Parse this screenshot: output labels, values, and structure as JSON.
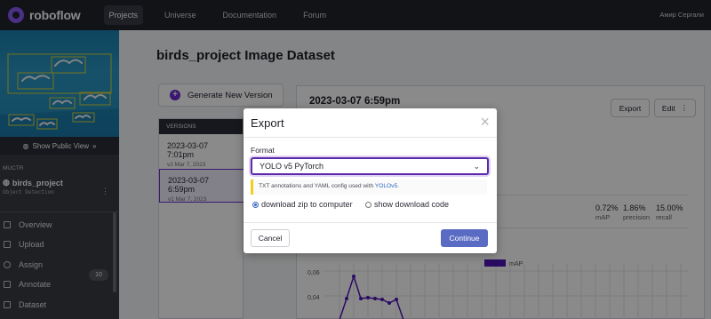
{
  "brand": {
    "name": "roboflow"
  },
  "nav": {
    "items": [
      "Projects",
      "Universe",
      "Documentation",
      "Forum"
    ],
    "active": "Projects"
  },
  "user": {
    "name": "Амир Сергали"
  },
  "sidebar": {
    "show_public_label": "Show Public View",
    "workspace": "MUCTR",
    "project_name": "birds_project",
    "project_type": "Object Detection",
    "items": [
      {
        "label": "Overview",
        "icon": "overview-icon"
      },
      {
        "label": "Upload",
        "icon": "upload-icon"
      },
      {
        "label": "Assign",
        "icon": "assign-icon"
      },
      {
        "label": "Annotate",
        "icon": "annotate-icon"
      },
      {
        "label": "Dataset",
        "icon": "dataset-icon",
        "badge": "10"
      }
    ]
  },
  "main": {
    "title": "birds_project Image Dataset",
    "generate_label": "Generate New Version",
    "versions_header": "VERSIONS",
    "versions": [
      {
        "title": "2023-03-07 7:01pm",
        "sub": "v2 Mar 7, 2023"
      },
      {
        "title": "2023-03-07 6:59pm",
        "sub": "v1 Mar 7, 2023"
      }
    ],
    "detail": {
      "date": "2023-03-07 6:59pm",
      "export_label": "Export",
      "edit_label": "Edit",
      "metrics": [
        {
          "value": "0.72%",
          "label": "mAP"
        },
        {
          "value": "1.86%",
          "label": "precision"
        },
        {
          "value": "15.00%",
          "label": "recall"
        }
      ],
      "legend": "mAP",
      "ticks": [
        "0,06",
        "0,04"
      ]
    }
  },
  "modal": {
    "title": "Export",
    "format_label": "Format",
    "format_value": "YOLO v5 PyTorch",
    "note_text": "TXT annotations and YAML config used with ",
    "note_link": "YOLOv5",
    "note_end": ".",
    "radio_zip": "download zip to computer",
    "radio_code": "show download code",
    "cancel_label": "Cancel",
    "continue_label": "Continue"
  },
  "colors": {
    "accent": "#6b2cd1",
    "continue": "#5a6bc3",
    "topbar": "#21232b",
    "sidebar": "#3a3c44"
  }
}
